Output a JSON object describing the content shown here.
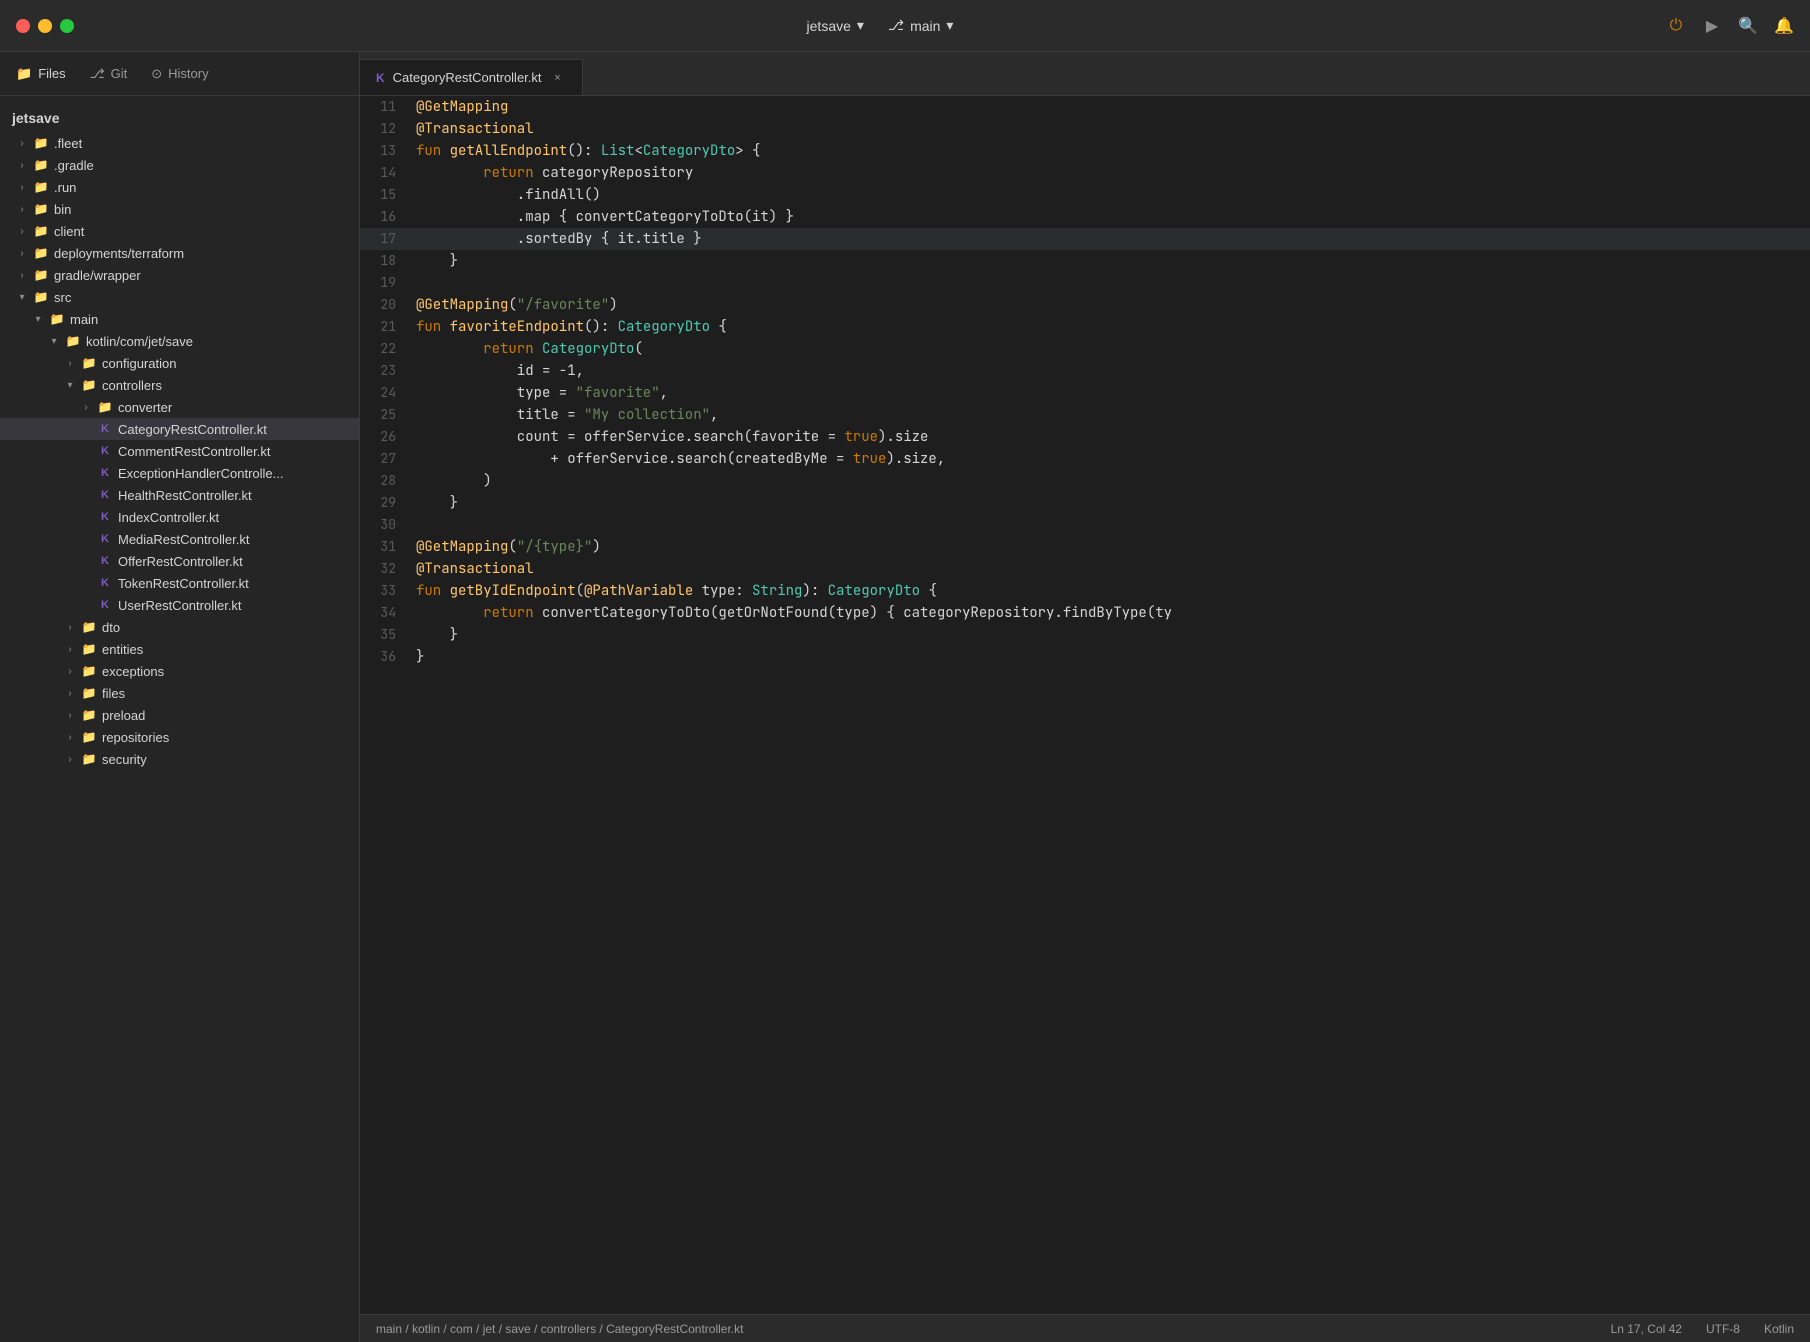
{
  "titlebar": {
    "project_name": "jetsave",
    "branch_name": "main",
    "chevron": "▾"
  },
  "sidebar": {
    "tabs": [
      {
        "label": "Files",
        "icon": "📁",
        "active": true
      },
      {
        "label": "Git",
        "icon": "⎇",
        "active": false
      },
      {
        "label": "History",
        "icon": "⊙",
        "active": false
      }
    ],
    "root": "jetsave",
    "tree": [
      {
        "id": "fleet",
        "label": ".fleet",
        "depth": 0,
        "type": "folder",
        "expanded": false
      },
      {
        "id": "gradle",
        "label": ".gradle",
        "depth": 0,
        "type": "folder",
        "expanded": false
      },
      {
        "id": "run",
        "label": ".run",
        "depth": 0,
        "type": "folder",
        "expanded": false
      },
      {
        "id": "bin",
        "label": "bin",
        "depth": 0,
        "type": "folder",
        "expanded": false
      },
      {
        "id": "client",
        "label": "client",
        "depth": 0,
        "type": "folder",
        "expanded": false
      },
      {
        "id": "deployments",
        "label": "deployments/terraform",
        "depth": 0,
        "type": "folder",
        "expanded": false
      },
      {
        "id": "gradle_wrapper",
        "label": "gradle/wrapper",
        "depth": 0,
        "type": "folder",
        "expanded": false
      },
      {
        "id": "src",
        "label": "src",
        "depth": 0,
        "type": "folder",
        "expanded": true
      },
      {
        "id": "main",
        "label": "main",
        "depth": 1,
        "type": "folder",
        "expanded": true
      },
      {
        "id": "kotlin",
        "label": "kotlin/com/jet/save",
        "depth": 2,
        "type": "folder",
        "expanded": true
      },
      {
        "id": "configuration",
        "label": "configuration",
        "depth": 3,
        "type": "folder",
        "expanded": false
      },
      {
        "id": "controllers",
        "label": "controllers",
        "depth": 3,
        "type": "folder",
        "expanded": true
      },
      {
        "id": "converter",
        "label": "converter",
        "depth": 4,
        "type": "folder",
        "expanded": false
      },
      {
        "id": "CategoryRestController",
        "label": "CategoryRestController.kt",
        "depth": 4,
        "type": "kotlin",
        "active": true
      },
      {
        "id": "CommentRestController",
        "label": "CommentRestController.kt",
        "depth": 4,
        "type": "kotlin"
      },
      {
        "id": "ExceptionHandlerController",
        "label": "ExceptionHandlerControlle...",
        "depth": 4,
        "type": "kotlin"
      },
      {
        "id": "HealthRestController",
        "label": "HealthRestController.kt",
        "depth": 4,
        "type": "kotlin"
      },
      {
        "id": "IndexController",
        "label": "IndexController.kt",
        "depth": 4,
        "type": "kotlin"
      },
      {
        "id": "MediaRestController",
        "label": "MediaRestController.kt",
        "depth": 4,
        "type": "kotlin"
      },
      {
        "id": "OfferRestController",
        "label": "OfferRestController.kt",
        "depth": 4,
        "type": "kotlin"
      },
      {
        "id": "TokenRestController",
        "label": "TokenRestController.kt",
        "depth": 4,
        "type": "kotlin"
      },
      {
        "id": "UserRestController",
        "label": "UserRestController.kt",
        "depth": 4,
        "type": "kotlin"
      },
      {
        "id": "dto",
        "label": "dto",
        "depth": 3,
        "type": "folder",
        "expanded": false
      },
      {
        "id": "entities",
        "label": "entities",
        "depth": 3,
        "type": "folder",
        "expanded": false
      },
      {
        "id": "exceptions",
        "label": "exceptions",
        "depth": 3,
        "type": "folder",
        "expanded": false
      },
      {
        "id": "files",
        "label": "files",
        "depth": 3,
        "type": "folder",
        "expanded": false
      },
      {
        "id": "preload",
        "label": "preload",
        "depth": 3,
        "type": "folder",
        "expanded": false
      },
      {
        "id": "repositories",
        "label": "repositories",
        "depth": 3,
        "type": "folder",
        "expanded": false
      },
      {
        "id": "security",
        "label": "security",
        "depth": 3,
        "type": "folder",
        "expanded": false
      }
    ]
  },
  "editor": {
    "tab_name": "CategoryRestController.kt",
    "lines": [
      {
        "n": 11,
        "tokens": [
          {
            "t": "annotation",
            "v": "@GetMapping"
          }
        ]
      },
      {
        "n": 12,
        "tokens": [
          {
            "t": "annotation",
            "v": "@Transactional"
          }
        ]
      },
      {
        "n": 13,
        "tokens": [
          {
            "t": "kw",
            "v": "fun "
          },
          {
            "t": "fn",
            "v": "getAllEndpoint"
          },
          {
            "t": "plain",
            "v": "(): "
          },
          {
            "t": "type",
            "v": "List"
          },
          {
            "t": "plain",
            "v": "<"
          },
          {
            "t": "type",
            "v": "CategoryDto"
          },
          {
            "t": "plain",
            "v": "> {"
          }
        ]
      },
      {
        "n": 14,
        "tokens": [
          {
            "t": "plain",
            "v": "        "
          },
          {
            "t": "kw",
            "v": "return "
          },
          {
            "t": "plain",
            "v": "categoryRepository"
          }
        ]
      },
      {
        "n": 15,
        "tokens": [
          {
            "t": "plain",
            "v": "            .findAll()"
          }
        ]
      },
      {
        "n": 16,
        "tokens": [
          {
            "t": "plain",
            "v": "            .map { convertCategoryToDto(it) }"
          }
        ]
      },
      {
        "n": 17,
        "tokens": [
          {
            "t": "plain",
            "v": "            .sortedBy { it.title }"
          }
        ],
        "highlight": true
      },
      {
        "n": 18,
        "tokens": [
          {
            "t": "plain",
            "v": "    }"
          }
        ]
      },
      {
        "n": 19,
        "tokens": [
          {
            "t": "plain",
            "v": ""
          }
        ]
      },
      {
        "n": 20,
        "tokens": [
          {
            "t": "annotation",
            "v": "@GetMapping"
          },
          {
            "t": "plain",
            "v": "("
          },
          {
            "t": "string",
            "v": "\"/favorite\""
          },
          {
            "t": "plain",
            "v": ")"
          }
        ]
      },
      {
        "n": 21,
        "tokens": [
          {
            "t": "kw",
            "v": "fun "
          },
          {
            "t": "fn",
            "v": "favoriteEndpoint"
          },
          {
            "t": "plain",
            "v": "(): "
          },
          {
            "t": "type",
            "v": "CategoryDto"
          },
          {
            "t": "plain",
            "v": " {"
          }
        ]
      },
      {
        "n": 22,
        "tokens": [
          {
            "t": "plain",
            "v": "        "
          },
          {
            "t": "kw",
            "v": "return "
          },
          {
            "t": "type",
            "v": "CategoryDto"
          },
          {
            "t": "plain",
            "v": "("
          }
        ]
      },
      {
        "n": 23,
        "tokens": [
          {
            "t": "plain",
            "v": "            id = -1,"
          }
        ]
      },
      {
        "n": 24,
        "tokens": [
          {
            "t": "plain",
            "v": "            type = "
          },
          {
            "t": "string",
            "v": "\"favorite\""
          },
          {
            "t": "plain",
            "v": ","
          }
        ]
      },
      {
        "n": 25,
        "tokens": [
          {
            "t": "plain",
            "v": "            title = "
          },
          {
            "t": "string",
            "v": "\"My collection\""
          },
          {
            "t": "plain",
            "v": ","
          }
        ]
      },
      {
        "n": 26,
        "tokens": [
          {
            "t": "plain",
            "v": "            count = offerService.search(favorite = "
          },
          {
            "t": "bool",
            "v": "true"
          },
          {
            "t": "plain",
            "v": ").size"
          }
        ]
      },
      {
        "n": 27,
        "tokens": [
          {
            "t": "plain",
            "v": "                + offerService.search(createdByMe = "
          },
          {
            "t": "bool",
            "v": "true"
          },
          {
            "t": "plain",
            "v": ").size,"
          }
        ]
      },
      {
        "n": 28,
        "tokens": [
          {
            "t": "plain",
            "v": "        )"
          }
        ]
      },
      {
        "n": 29,
        "tokens": [
          {
            "t": "plain",
            "v": "    }"
          }
        ]
      },
      {
        "n": 30,
        "tokens": [
          {
            "t": "plain",
            "v": ""
          }
        ]
      },
      {
        "n": 31,
        "tokens": [
          {
            "t": "annotation",
            "v": "@GetMapping"
          },
          {
            "t": "plain",
            "v": "("
          },
          {
            "t": "string",
            "v": "\"/{type}\""
          },
          {
            "t": "plain",
            "v": ")"
          }
        ]
      },
      {
        "n": 32,
        "tokens": [
          {
            "t": "annotation",
            "v": "@Transactional"
          }
        ]
      },
      {
        "n": 33,
        "tokens": [
          {
            "t": "kw",
            "v": "fun "
          },
          {
            "t": "fn",
            "v": "getByIdEndpoint"
          },
          {
            "t": "plain",
            "v": "("
          },
          {
            "t": "annotation",
            "v": "@PathVariable"
          },
          {
            "t": "plain",
            "v": " type: "
          },
          {
            "t": "type",
            "v": "String"
          },
          {
            "t": "plain",
            "v": "): "
          },
          {
            "t": "type",
            "v": "CategoryDto"
          },
          {
            "t": "plain",
            "v": " {"
          }
        ]
      },
      {
        "n": 34,
        "tokens": [
          {
            "t": "plain",
            "v": "        "
          },
          {
            "t": "kw",
            "v": "return "
          },
          {
            "t": "plain",
            "v": "convertCategoryToDto(getOrNotFound(type) { categoryRepository.findByType(ty"
          }
        ]
      },
      {
        "n": 35,
        "tokens": [
          {
            "t": "plain",
            "v": "    }"
          }
        ]
      },
      {
        "n": 36,
        "tokens": [
          {
            "t": "plain",
            "v": "}"
          }
        ]
      }
    ]
  },
  "statusbar": {
    "path": "main / kotlin / com / jet / save / controllers / CategoryRestController.kt",
    "position": "Ln 17, Col 42",
    "encoding": "UTF-8",
    "language": "Kotlin"
  },
  "colors": {
    "annotation": "#ffc66d",
    "keyword": "#cc7a00",
    "string": "#6a8759",
    "type": "#4ec9b0",
    "boolean": "#cc7a00"
  }
}
